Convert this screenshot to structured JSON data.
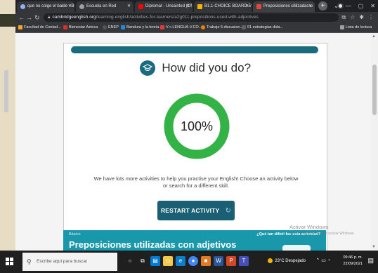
{
  "tabs": [
    {
      "label": "que no coige el balde - Busc",
      "icon_color": "#8ab4f8"
    },
    {
      "label": "Escuela en Red",
      "icon_color": "#9aa0a6"
    },
    {
      "label": "Diplomat - Unsainted (Of",
      "icon_color": "#ff0000"
    },
    {
      "label": "B1.1-CHOICE BOARD-5VID3",
      "icon_color": "#f4b400"
    },
    {
      "label": "Preposiciones utilizadas con",
      "icon_color": "#e8453c",
      "active": true
    }
  ],
  "address": {
    "host": "cambridgeenglish.org",
    "path": "/learning-english/activities-for-learners/a2g011-prepositions-used-with-adjectives"
  },
  "bookmarks": [
    {
      "label": "Facultad de Contad...",
      "icon_color": "#f5a623"
    },
    {
      "label": "Bienestar Azteca",
      "icon_color": "#d93025"
    },
    {
      "label": "ENEP",
      "icon_color": "#555555"
    },
    {
      "label": "Bandura y la teoria...",
      "icon_color": "#1e88e5"
    },
    {
      "label": "V.<.LENGUA-V.CO...",
      "icon_color": "#e53935"
    },
    {
      "label": "Trabajo 5 discusion...",
      "icon_color": "#f57c00"
    },
    {
      "label": "61 estrategias dida...",
      "icon_color": "#5f6368"
    }
  ],
  "bookmarks_right": "Lista de lectura",
  "result": {
    "title": "How did you do?",
    "score": "100%",
    "score_fraction": 1.0,
    "ring_color": "#33b345",
    "message": "We have lots more activities to help you practise your English! Choose an activity below or search for a different skill.",
    "restart_label": "RESTART ACTIVITY"
  },
  "info": {
    "level": "Básico",
    "title": "Preposiciones utilizadas con adjetivos",
    "question": "¿Qué tan difícil fue esta actividad?"
  },
  "watermark": {
    "line1": "Activar Windows",
    "line2": "Ve a Configuración para activar Windows."
  },
  "taskbar": {
    "search_placeholder": "Escribe aquí para buscar",
    "weather": "23°C  Despejado",
    "time": "09:46 p. m.",
    "date": "22/09/2021"
  },
  "colors": {
    "accent": "#1a6b80",
    "button": "#1a5f73",
    "info_bar": "#1a98ab"
  }
}
